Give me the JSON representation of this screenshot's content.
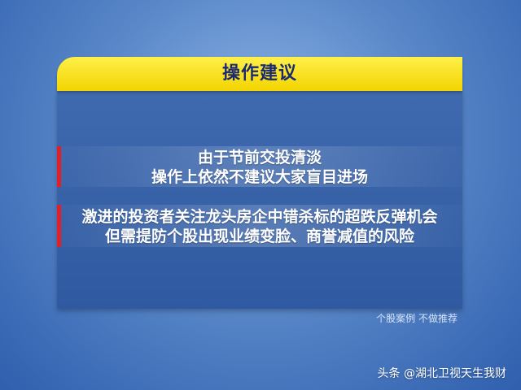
{
  "panel": {
    "title": "操作建议",
    "points": [
      {
        "lines": [
          "由于节前交投清淡",
          "操作上依然不建议大家盲目进场"
        ]
      },
      {
        "lines": [
          "激进的投资者关注龙头房企中错杀标的超跌反弹机会",
          "但需提防个股出现业绩变脸、商誉减值的风险"
        ]
      }
    ]
  },
  "disclaimer": "个股案例  不做推荐",
  "watermark": "头条 @湖北卫视天生我财",
  "colors": {
    "header_yellow": "#f2d400",
    "title_navy": "#1a2a72",
    "accent_red": "#e21f26",
    "panel_blue": "#3f6aaf"
  }
}
